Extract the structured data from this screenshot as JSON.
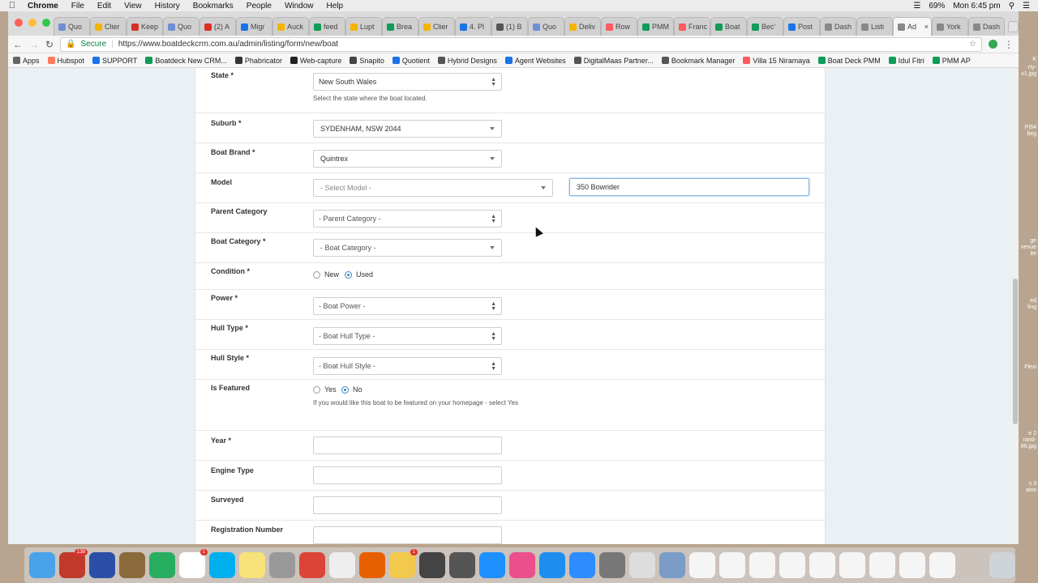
{
  "menubar": {
    "apple": "",
    "app": "Chrome",
    "menus": [
      "File",
      "Edit",
      "View",
      "History",
      "Bookmarks",
      "People",
      "Window",
      "Help"
    ],
    "battery": "69%",
    "clock": "Mon 6:45 pm"
  },
  "tabs": [
    {
      "label": "Quo",
      "color": "#6f8fd6"
    },
    {
      "label": "Clier",
      "color": "#f4b400"
    },
    {
      "label": "Keep",
      "color": "#d93025"
    },
    {
      "label": "Quo",
      "color": "#6f8fd6"
    },
    {
      "label": "(2) A",
      "color": "#d93025"
    },
    {
      "label": "Migr",
      "color": "#1a73e8"
    },
    {
      "label": "Auck",
      "color": "#f4b400"
    },
    {
      "label": "feed",
      "color": "#0f9d58"
    },
    {
      "label": "Lupt",
      "color": "#f4b400"
    },
    {
      "label": "Brea",
      "color": "#0f9d58"
    },
    {
      "label": "Clier",
      "color": "#f4b400"
    },
    {
      "label": "4. Pl",
      "color": "#1a73e8"
    },
    {
      "label": "(1) B",
      "color": "#555555"
    },
    {
      "label": "Quo",
      "color": "#6f8fd6"
    },
    {
      "label": "Deliv",
      "color": "#f4b400"
    },
    {
      "label": "Row",
      "color": "#ff5a5f"
    },
    {
      "label": "PMM",
      "color": "#0f9d58"
    },
    {
      "label": "Franc",
      "color": "#ff5a5f"
    },
    {
      "label": "Boat",
      "color": "#0f9d58"
    },
    {
      "label": "Bec'",
      "color": "#0f9d58"
    },
    {
      "label": "Post",
      "color": "#1a73e8"
    },
    {
      "label": "Dash",
      "color": "#888888"
    },
    {
      "label": "Listi",
      "color": "#888888"
    },
    {
      "label": "Ad",
      "color": "#888888",
      "active": true
    },
    {
      "label": "York",
      "color": "#888888"
    },
    {
      "label": "Dash",
      "color": "#888888"
    }
  ],
  "address": {
    "secure_label": "Secure",
    "url": "https://www.boatdeckcrm.com.au/admin/listing/form/new/boat"
  },
  "bookmarks": [
    {
      "label": "Apps",
      "color": "#666666"
    },
    {
      "label": "Hubspot",
      "color": "#ff7a59"
    },
    {
      "label": "SUPPORT",
      "color": "#1a73e8"
    },
    {
      "label": "Boatdeck New CRM...",
      "color": "#0f9d58"
    },
    {
      "label": "Phabricator",
      "color": "#333333"
    },
    {
      "label": "Web-capture",
      "color": "#222222"
    },
    {
      "label": "Snapito",
      "color": "#444444"
    },
    {
      "label": "Quotient",
      "color": "#1a73e8"
    },
    {
      "label": "Hybrid Designs",
      "color": "#555555"
    },
    {
      "label": "Agent Websites",
      "color": "#1a73e8"
    },
    {
      "label": "DigitalMaas Partner...",
      "color": "#555555"
    },
    {
      "label": "Bookmark Manager",
      "color": "#555555"
    },
    {
      "label": "Villa 15 Niramaya",
      "color": "#ff5a5f"
    },
    {
      "label": "Boat Deck PMM",
      "color": "#0f9d58"
    },
    {
      "label": "Idul Fitri",
      "color": "#0f9d58"
    },
    {
      "label": "PMM AP",
      "color": "#0f9d58"
    }
  ],
  "form": {
    "state": {
      "label": "State *",
      "value": "New South Wales",
      "help": "Select the state where the boat located."
    },
    "suburb": {
      "label": "Suburb *",
      "value": "SYDENHAM, NSW 2044"
    },
    "brand": {
      "label": "Boat Brand *",
      "value": "Quintrex"
    },
    "model": {
      "label": "Model",
      "value": "- Select Model -",
      "custom_value": "350 Bowrider"
    },
    "parent_category": {
      "label": "Parent Category",
      "value": "- Parent Category -"
    },
    "boat_category": {
      "label": "Boat Category *",
      "value": "- Boat Category -"
    },
    "condition": {
      "label": "Condition *",
      "options": [
        "New",
        "Used"
      ],
      "selected": "Used"
    },
    "power": {
      "label": "Power *",
      "value": "- Boat Power -"
    },
    "hull_type": {
      "label": "Hull Type *",
      "value": "- Boat Hull Type -"
    },
    "hull_style": {
      "label": "Hull Style *",
      "value": "- Boat Hull Style -"
    },
    "featured": {
      "label": "Is Featured",
      "options": [
        "Yes",
        "No"
      ],
      "selected": "No",
      "help": "If you would like this boat to be featured on your homepage - select Yes"
    },
    "year": {
      "label": "Year *",
      "value": ""
    },
    "engine_type": {
      "label": "Engine Type",
      "value": ""
    },
    "surveyed": {
      "label": "Surveyed",
      "value": ""
    },
    "registration": {
      "label": "Registration Number",
      "value": ""
    }
  },
  "desktop_labels": [
    "K",
    "rty-",
    "v1.jpg",
    "P|64",
    "beg",
    "ge",
    "venue",
    "ite",
    "ed",
    "ling",
    "Flexi",
    "e 2",
    "rand-",
    "86.jpg",
    "s 3",
    "ains"
  ],
  "dock": [
    {
      "name": "finder",
      "color": "#4aa3e8"
    },
    {
      "name": "photo-booth",
      "color": "#c0392b",
      "badge": "138"
    },
    {
      "name": "launchpad",
      "color": "#2b4fa8"
    },
    {
      "name": "notes-book",
      "color": "#8a6a3a"
    },
    {
      "name": "sheets",
      "color": "#27ae60"
    },
    {
      "name": "calendar",
      "color": "#ffffff",
      "badge": "1"
    },
    {
      "name": "skype",
      "color": "#00aff0"
    },
    {
      "name": "stickies",
      "color": "#f7e27a"
    },
    {
      "name": "scripts",
      "color": "#999999"
    },
    {
      "name": "chrome",
      "color": "#db4437"
    },
    {
      "name": "textedit",
      "color": "#eeeeee"
    },
    {
      "name": "firefox",
      "color": "#e66000"
    },
    {
      "name": "photos",
      "color": "#f2c94c",
      "badge": "1"
    },
    {
      "name": "dvd",
      "color": "#444444"
    },
    {
      "name": "calculator",
      "color": "#555555"
    },
    {
      "name": "safari",
      "color": "#1e90ff"
    },
    {
      "name": "itunes",
      "color": "#ec4f8c"
    },
    {
      "name": "app-store",
      "color": "#1d8ef0"
    },
    {
      "name": "zoom",
      "color": "#2d8cff"
    },
    {
      "name": "system-prefs",
      "color": "#777777"
    },
    {
      "name": "script-editor",
      "color": "#dddddd"
    },
    {
      "name": "preview",
      "color": "#7a9cc6"
    },
    {
      "name": "doc-1",
      "color": "#f5f5f5"
    },
    {
      "name": "doc-2",
      "color": "#f5f5f5"
    },
    {
      "name": "doc-3",
      "color": "#f5f5f5"
    },
    {
      "name": "doc-4",
      "color": "#f5f5f5"
    },
    {
      "name": "doc-5",
      "color": "#f5f5f5"
    },
    {
      "name": "doc-6",
      "color": "#f5f5f5"
    },
    {
      "name": "doc-7",
      "color": "#f5f5f5"
    },
    {
      "name": "doc-8",
      "color": "#f5f5f5"
    },
    {
      "name": "doc-9",
      "color": "#f5f5f5"
    },
    {
      "name": "trash",
      "color": "#cfd4d8"
    }
  ]
}
